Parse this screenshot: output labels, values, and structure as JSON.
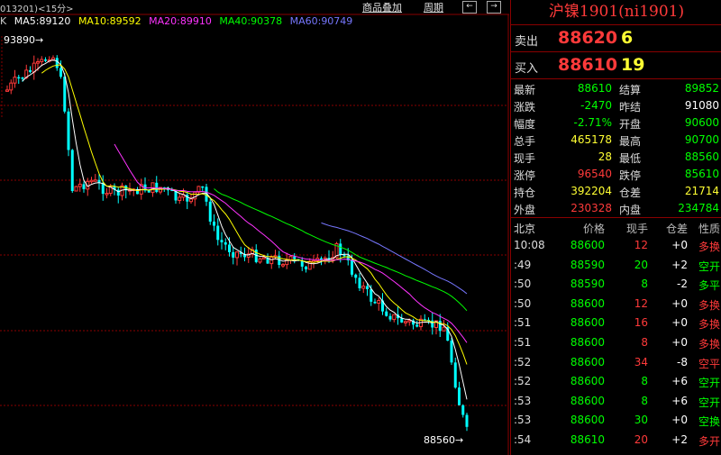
{
  "chart": {
    "header_left": "013201)<15分>",
    "btn_overlay": "商品叠加",
    "btn_period": "周期",
    "icon_left_label": "←",
    "icon_right_label": "→",
    "ma_prefix": "K",
    "ma": [
      {
        "label": "MA5:89120",
        "color": "#ffffff"
      },
      {
        "label": "MA10:89592",
        "color": "#ffff00"
      },
      {
        "label": "MA20:89910",
        "color": "#ff33ff"
      },
      {
        "label": "MA40:90378",
        "color": "#00ff00"
      },
      {
        "label": "MA60:90749",
        "color": "#7777ff"
      }
    ],
    "high_label": "93890",
    "low_label": "88560",
    "colors": {
      "up": "#ff3a3a",
      "down": "#00ffff",
      "grid": "#8a0000"
    },
    "chart_data": {
      "type": "candlestick",
      "interval": "15分",
      "high_marker": 93890,
      "low_marker": 88560,
      "moving_averages": {
        "MA5": 89120,
        "MA10": 89592,
        "MA20": 89910,
        "MA40": 90378,
        "MA60": 90749
      }
    }
  },
  "quote": {
    "title": "沪镍1901(ni1901)",
    "sell": {
      "label": "卖出",
      "price": "88620",
      "vol": "6"
    },
    "buy": {
      "label": "买入",
      "price": "88610",
      "vol": "19"
    },
    "stats": [
      {
        "l1": "最新",
        "v1": "88610",
        "c1": "#00ff00",
        "l2": "结算",
        "v2": "89852",
        "c2": "#00ff00"
      },
      {
        "l1": "涨跌",
        "v1": "-2470",
        "c1": "#00ff00",
        "l2": "昨结",
        "v2": "91080",
        "c2": "#ffffff"
      },
      {
        "l1": "幅度",
        "v1": "-2.71%",
        "c1": "#00ff00",
        "l2": "开盘",
        "v2": "90600",
        "c2": "#00ff00"
      },
      {
        "l1": "总手",
        "v1": "465178",
        "c1": "#ffff33",
        "l2": "最高",
        "v2": "90700",
        "c2": "#00ff00"
      },
      {
        "l1": "现手",
        "v1": "28",
        "c1": "#ffff33",
        "l2": "最低",
        "v2": "88560",
        "c2": "#00ff00"
      },
      {
        "l1": "涨停",
        "v1": "96540",
        "c1": "#ff3a3a",
        "l2": "跌停",
        "v2": "85610",
        "c2": "#00ff00"
      },
      {
        "l1": "持仓",
        "v1": "392204",
        "c1": "#ffff33",
        "l2": "仓差",
        "v2": "21714",
        "c2": "#ffff33"
      },
      {
        "l1": "外盘",
        "v1": "230328",
        "c1": "#ff3a3a",
        "l2": "内盘",
        "v2": "234784",
        "c2": "#00ff00"
      }
    ],
    "ticks_header": {
      "time": "北京",
      "price": "价格",
      "vol": "现手",
      "oi": "仓差",
      "type": "性质"
    },
    "ticks": [
      {
        "time": "10:08",
        "price": "88600",
        "vol": "12",
        "oi": "+0",
        "type": "多换",
        "vc": "#ff3a3a",
        "tc": "#ff3a3a"
      },
      {
        "time": ":49",
        "price": "88590",
        "vol": "20",
        "oi": "+2",
        "type": "空开",
        "vc": "#00ff00",
        "tc": "#00ff00"
      },
      {
        "time": ":50",
        "price": "88590",
        "vol": "8",
        "oi": "-2",
        "type": "多平",
        "vc": "#00ff00",
        "tc": "#00ff00"
      },
      {
        "time": ":50",
        "price": "88600",
        "vol": "12",
        "oi": "+0",
        "type": "多换",
        "vc": "#ff3a3a",
        "tc": "#ff3a3a"
      },
      {
        "time": ":51",
        "price": "88600",
        "vol": "16",
        "oi": "+0",
        "type": "多换",
        "vc": "#ff3a3a",
        "tc": "#ff3a3a"
      },
      {
        "time": ":51",
        "price": "88600",
        "vol": "8",
        "oi": "+0",
        "type": "多换",
        "vc": "#ff3a3a",
        "tc": "#ff3a3a"
      },
      {
        "time": ":52",
        "price": "88600",
        "vol": "34",
        "oi": "-8",
        "type": "空平",
        "vc": "#ff3a3a",
        "tc": "#ff3a3a"
      },
      {
        "time": ":52",
        "price": "88600",
        "vol": "8",
        "oi": "+6",
        "type": "空开",
        "vc": "#00ff00",
        "tc": "#00ff00"
      },
      {
        "time": ":53",
        "price": "88600",
        "vol": "8",
        "oi": "+6",
        "type": "空开",
        "vc": "#00ff00",
        "tc": "#00ff00"
      },
      {
        "time": ":53",
        "price": "88600",
        "vol": "30",
        "oi": "+0",
        "type": "空换",
        "vc": "#00ff00",
        "tc": "#00ff00"
      },
      {
        "time": ":54",
        "price": "88610",
        "vol": "20",
        "oi": "+2",
        "type": "多开",
        "vc": "#ff3a3a",
        "tc": "#ff3a3a"
      }
    ]
  }
}
